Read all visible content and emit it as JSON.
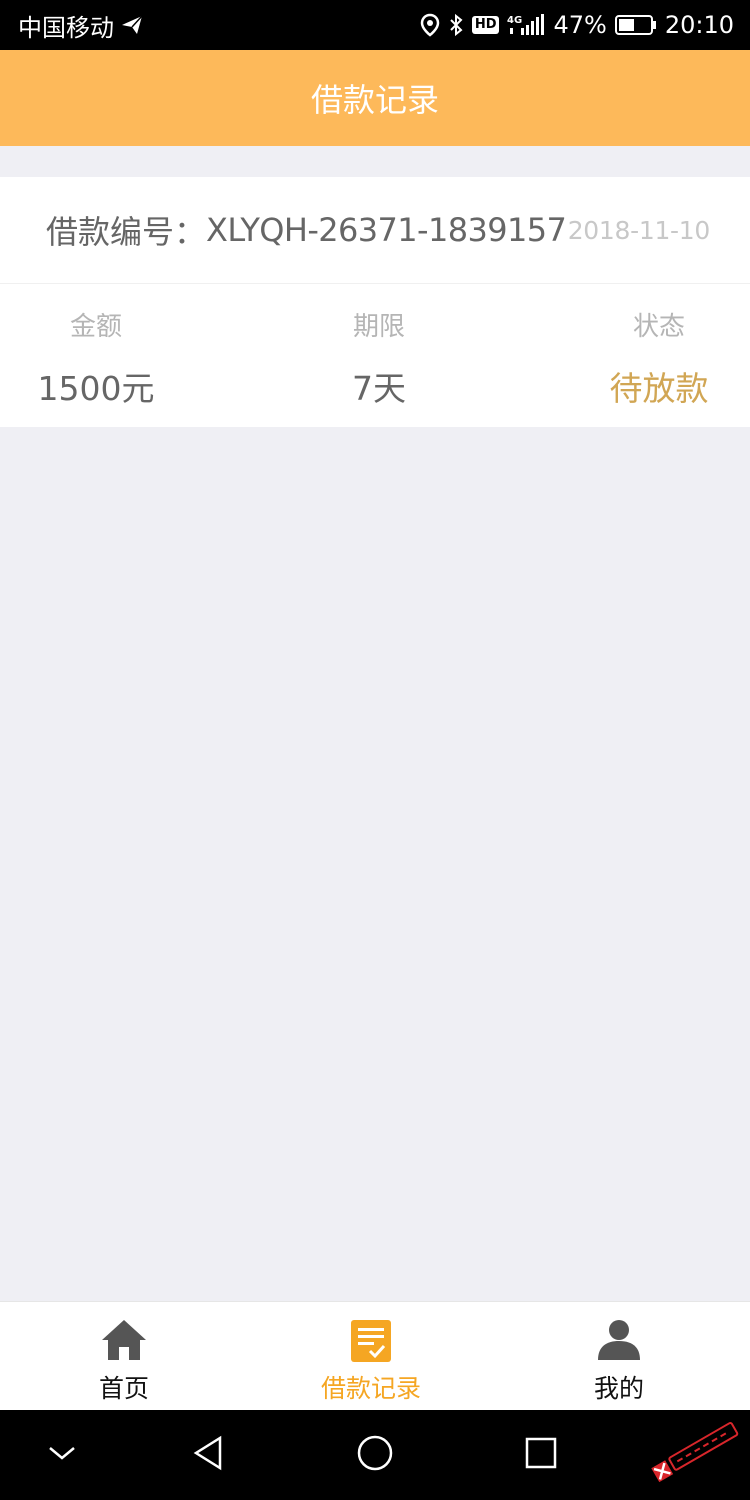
{
  "status_bar": {
    "carrier": "中国移动",
    "hd": "HD",
    "network": "4G",
    "battery": "47%",
    "time": "20:10"
  },
  "header": {
    "title": "借款记录"
  },
  "record": {
    "number_label": "借款编号：",
    "number_value": "XLYQH-26371-1839157",
    "date": "2018-11-10",
    "amount_label": "金额",
    "amount_value": "1500元",
    "term_label": "期限",
    "term_value": "7天",
    "status_label": "状态",
    "status_value": "待放款"
  },
  "tabs": [
    {
      "label": "首页",
      "icon": "home-icon",
      "active": false
    },
    {
      "label": "借款记录",
      "icon": "records-icon",
      "active": true
    },
    {
      "label": "我的",
      "icon": "user-icon",
      "active": false
    }
  ],
  "colors": {
    "header_bg": "#fdb95a",
    "status_accent": "#d1a654",
    "active_tab": "#f5a623",
    "page_bg": "#efeff4"
  }
}
